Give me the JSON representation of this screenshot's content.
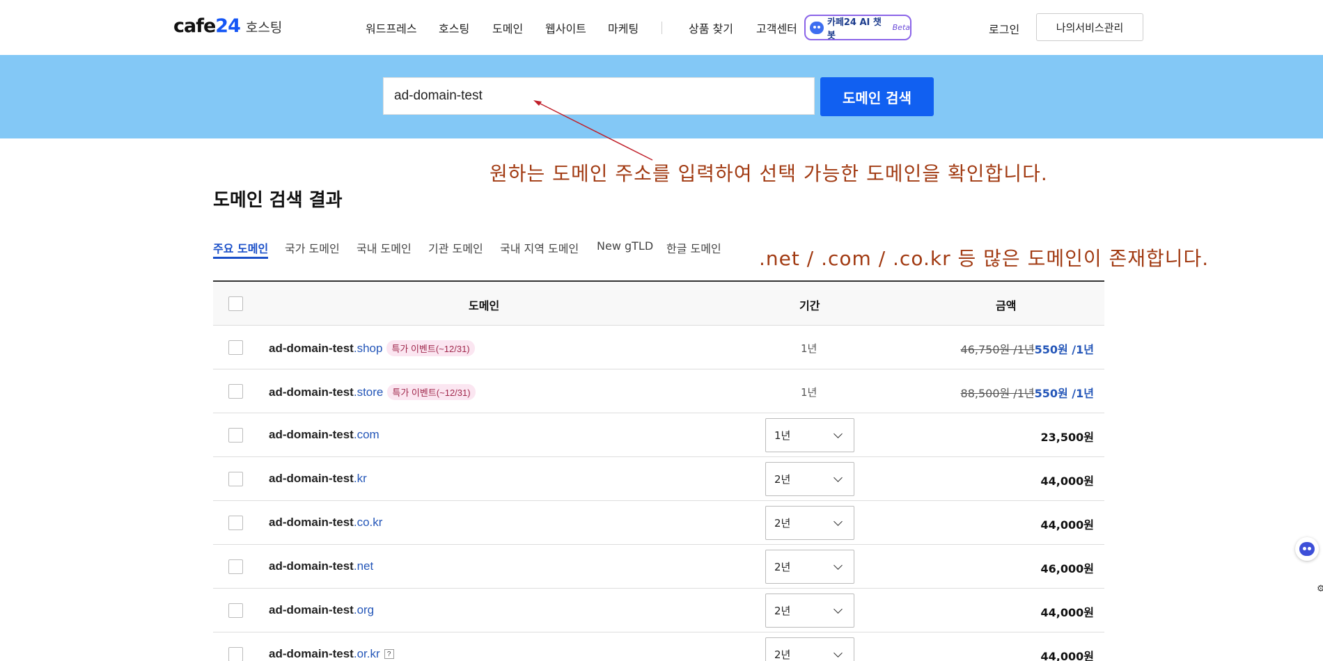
{
  "header": {
    "logo_text": "cafe",
    "logo_num": "24",
    "logo_sub": "호스팅",
    "nav": [
      "워드프레스",
      "호스팅",
      "도메인",
      "웹사이트",
      "마케팅",
      "상품 찾기",
      "고객센터"
    ],
    "ai_label": "카페24 AI 챗봇",
    "ai_beta": "Beta",
    "login": "로그인",
    "my_service": "나의서비스관리"
  },
  "search": {
    "value": "ad-domain-test",
    "button": "도메인 검색"
  },
  "annotations": {
    "search_note": "원하는 도메인 주소를 입력하여 선택 가능한 도메인을 확인합니다.",
    "domain_note": ".net / .com / .co.kr 등 많은 도메인이 존재합니다."
  },
  "results": {
    "title": "도메인 검색 결과",
    "tabs": [
      "주요 도메인",
      "국가 도메인",
      "국내 도메인",
      "기관 도메인",
      "국내 지역 도메인",
      "New gTLD",
      "한글 도메인"
    ],
    "columns": {
      "domain": "도메인",
      "period": "기간",
      "price": "금액"
    },
    "rows": [
      {
        "base": "ad-domain-test",
        "tld": ".shop",
        "badge": "특가 이벤트(~12/31)",
        "period": "1년",
        "old_price": "46,750원 /1년",
        "new_price": "550원 /1년"
      },
      {
        "base": "ad-domain-test",
        "tld": ".store",
        "badge": "특가 이벤트(~12/31)",
        "period": "1년",
        "old_price": "88,500원 /1년",
        "new_price": "550원 /1년"
      },
      {
        "base": "ad-domain-test",
        "tld": ".com",
        "period": "1년",
        "price": "23,500원"
      },
      {
        "base": "ad-domain-test",
        "tld": ".kr",
        "period": "2년",
        "price": "44,000원"
      },
      {
        "base": "ad-domain-test",
        "tld": ".co.kr",
        "period": "2년",
        "price": "44,000원"
      },
      {
        "base": "ad-domain-test",
        "tld": ".net",
        "period": "2년",
        "price": "46,000원"
      },
      {
        "base": "ad-domain-test",
        "tld": ".org",
        "period": "2년",
        "price": "44,000원"
      },
      {
        "base": "ad-domain-test",
        "tld": ".or.kr",
        "help": "?",
        "period": "2년",
        "price": "44,000원"
      }
    ]
  },
  "colors": {
    "accent": "#1160f1",
    "search_band": "#83c8f6",
    "annotation": "#a13a12"
  }
}
